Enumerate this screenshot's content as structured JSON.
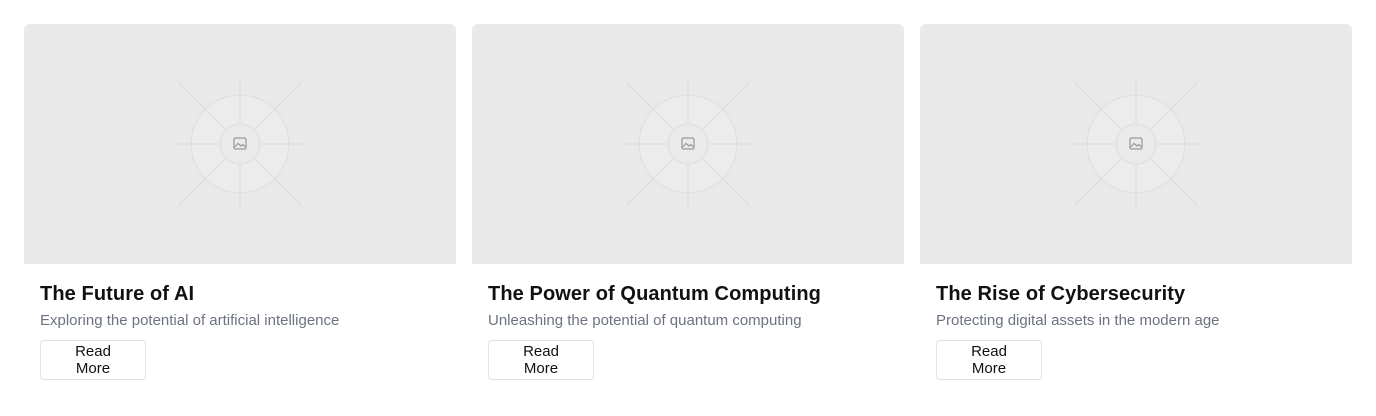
{
  "cards": [
    {
      "image_icon": "image-placeholder-icon",
      "title": "The Future of AI",
      "description": "Exploring the potential of artificial intelligence",
      "button_label": "Read More"
    },
    {
      "image_icon": "image-placeholder-icon",
      "title": "The Power of Quantum Computing",
      "description": "Unleashing the potential of quantum computing",
      "button_label": "Read More"
    },
    {
      "image_icon": "image-placeholder-icon",
      "title": "The Rise of Cybersecurity",
      "description": "Protecting digital assets in the modern age",
      "button_label": "Read More"
    }
  ],
  "colors": {
    "placeholder_bg": "#e9e9e9",
    "title": "#111111",
    "description": "#6b7280",
    "button_border": "#e2e2e2"
  }
}
